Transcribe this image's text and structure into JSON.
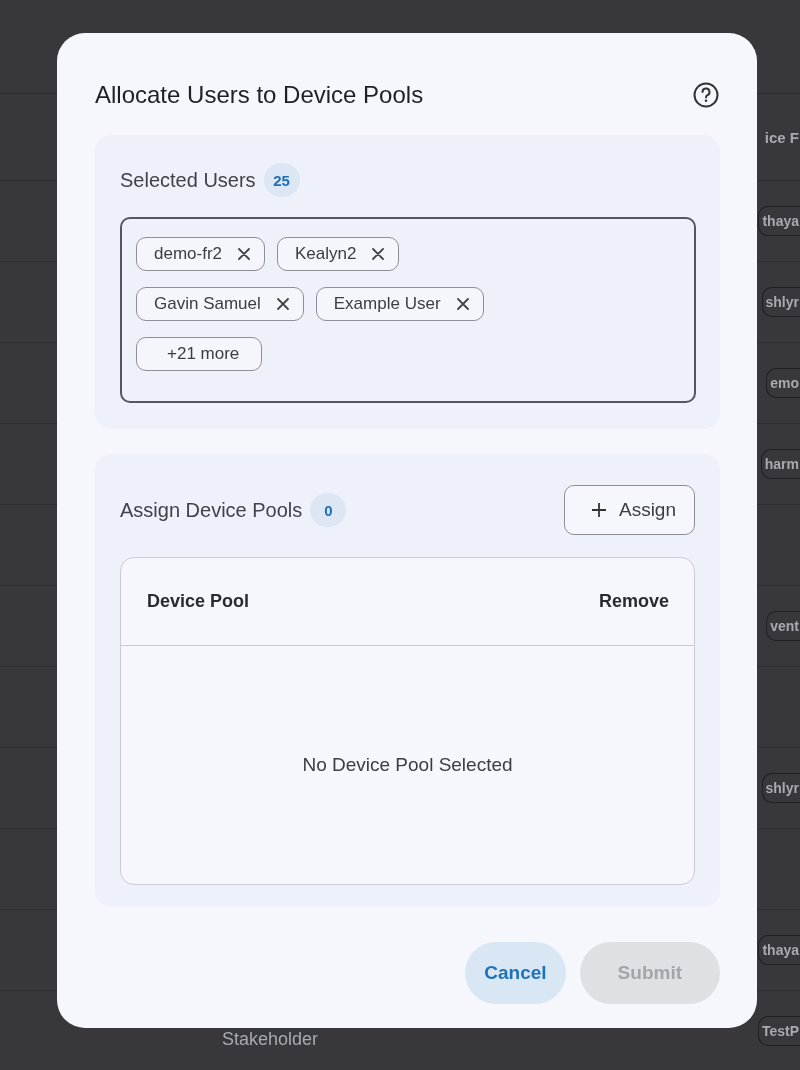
{
  "background_table": {
    "header": "ice F",
    "rows": [
      {
        "column_3": "thaya"
      },
      {
        "column_3": "shlyr"
      },
      {
        "column_3": "emo"
      },
      {
        "column_3": "harm"
      },
      {},
      {
        "column_3": "vent"
      },
      {},
      {
        "column_3": "shlyr"
      },
      {},
      {
        "column_3": "thaya"
      },
      {
        "column_2": "Stakeholder",
        "column_3": "TestP"
      }
    ]
  },
  "dialog": {
    "title": "Allocate Users to Device Pools",
    "selected_users": {
      "label": "Selected Users",
      "count": "25",
      "chips": [
        {
          "label": "demo-fr2",
          "removable": true
        },
        {
          "label": "Kealyn2",
          "removable": true
        },
        {
          "label": "Gavin Samuel",
          "removable": true
        },
        {
          "label": "Example User",
          "removable": true
        },
        {
          "label": "+21 more",
          "removable": false
        }
      ]
    },
    "device_pools": {
      "label": "Assign Device Pools",
      "count": "0",
      "assign_button": "Assign",
      "table": {
        "columns": [
          "Device Pool",
          "Remove"
        ],
        "empty_message": "No Device Pool Selected"
      }
    },
    "buttons": [
      {
        "label": "Cancel",
        "kind": "secondary",
        "disabled": false
      },
      {
        "label": "Submit",
        "kind": "primary",
        "disabled": true
      }
    ]
  }
}
